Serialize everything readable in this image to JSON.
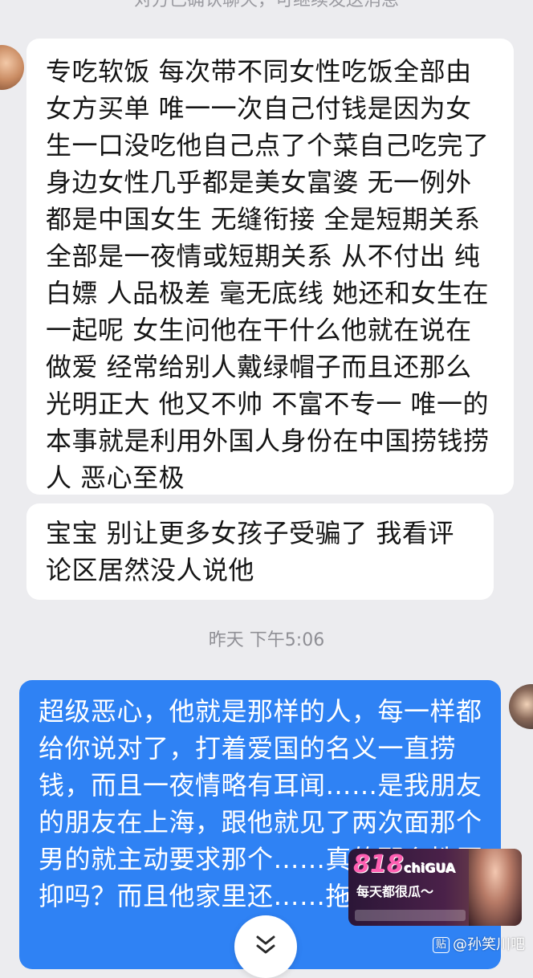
{
  "chat": {
    "top_notice": "对方已确认聊天，可继续发送消息",
    "messages": [
      {
        "text": "专吃软饭 每次带不同女性吃饭全部由女方买单 唯一一次自己付钱是因为女生一口没吃他自己点了个菜自己吃完了 身边女性几乎都是美女富婆 无一例外都是中国女生 无缝衔接 全是短期关系 全部是一夜情或短期关系 从不付出 纯白嫖 人品极差 毫无底线 她还和女生在一起呢 女生问他在干什么他就在说在做爱 经常给别人戴绿帽子而且还那么光明正大 他又不帅 不富不专一 唯一的本事就是利用外国人身份在中国捞钱捞人 恶心至极"
      },
      {
        "text": "宝宝 别让更多女孩子受骗了 我看评论区居然没人说他"
      },
      {
        "text": "超级恶心，他就是那样的人，每一样都给你说对了，打着爱国的名义一直捞钱，而且一夜情略有耳闻……是我朋友的朋友在上海，跟他就见了两次面那个男的就主动要求那个……真的那么性压抑吗？而且他家里还……拖鞋"
      }
    ],
    "timestamp": "昨天 下午5:06"
  },
  "overlay": {
    "promo_brand": "818",
    "promo_brand_suffix": "chiGUA",
    "promo_slogan": "每天都很瓜～",
    "watermark_badge": "贴",
    "watermark_user": "@孙笑川吧"
  },
  "icons": {
    "scroll_down": "double-chevron-down-icon"
  },
  "colors": {
    "background": "#ececef",
    "incoming_bubble": "#ffffff",
    "outgoing_bubble": "#2f82f4"
  }
}
